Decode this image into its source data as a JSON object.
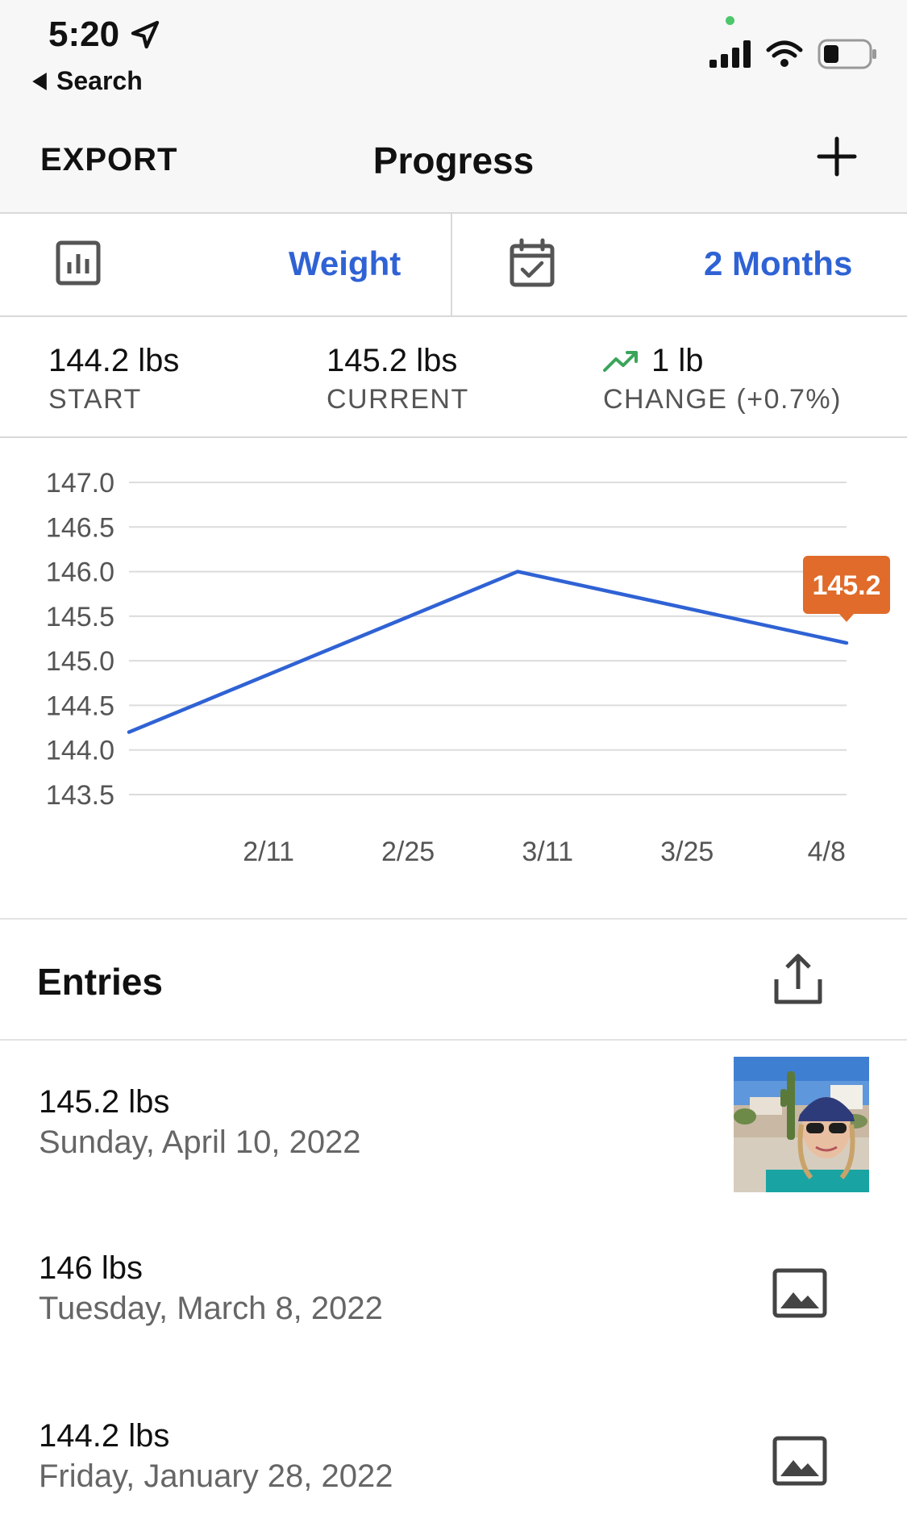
{
  "status": {
    "time": "5:20",
    "back_label": "Search"
  },
  "nav": {
    "export_label": "EXPORT",
    "title": "Progress"
  },
  "selector": {
    "metric_label": "Weight",
    "range_label": "2 Months"
  },
  "stats": {
    "start_value": "144.2 lbs",
    "start_label": "START",
    "current_value": "145.2 lbs",
    "current_label": "CURRENT",
    "change_value": "1 lb",
    "change_label": "CHANGE (+0.7%)"
  },
  "chart_data": {
    "type": "line",
    "y_ticks": [
      "147.0",
      "146.5",
      "146.0",
      "145.5",
      "145.0",
      "144.5",
      "144.0",
      "143.5"
    ],
    "x_ticks": [
      "2/11",
      "2/25",
      "3/11",
      "3/25",
      "4/8"
    ],
    "ylim": [
      143.5,
      147.0
    ],
    "xlim": [
      "2022-01-28",
      "2022-04-10"
    ],
    "series": [
      {
        "points": [
          {
            "x": "2022-01-28",
            "y": 144.2
          },
          {
            "x": "2022-03-08",
            "y": 146.0
          },
          {
            "x": "2022-04-10",
            "y": 145.2
          }
        ],
        "color": "#2f62d4"
      }
    ],
    "tooltip": "145.2",
    "tooltip_color": "#e06b2a",
    "grid": true
  },
  "entries": {
    "title": "Entries",
    "items": [
      {
        "weight": "145.2 lbs",
        "date": "Sunday, April 10, 2022",
        "has_photo": true
      },
      {
        "weight": "146 lbs",
        "date": "Tuesday, March 8, 2022",
        "has_photo": false
      },
      {
        "weight": "144.2 lbs",
        "date": "Friday, January 28, 2022",
        "has_photo": false
      }
    ]
  },
  "colors": {
    "accent": "#2f62d4",
    "trend_up": "#3aa55a",
    "tooltip": "#e06b2a"
  }
}
